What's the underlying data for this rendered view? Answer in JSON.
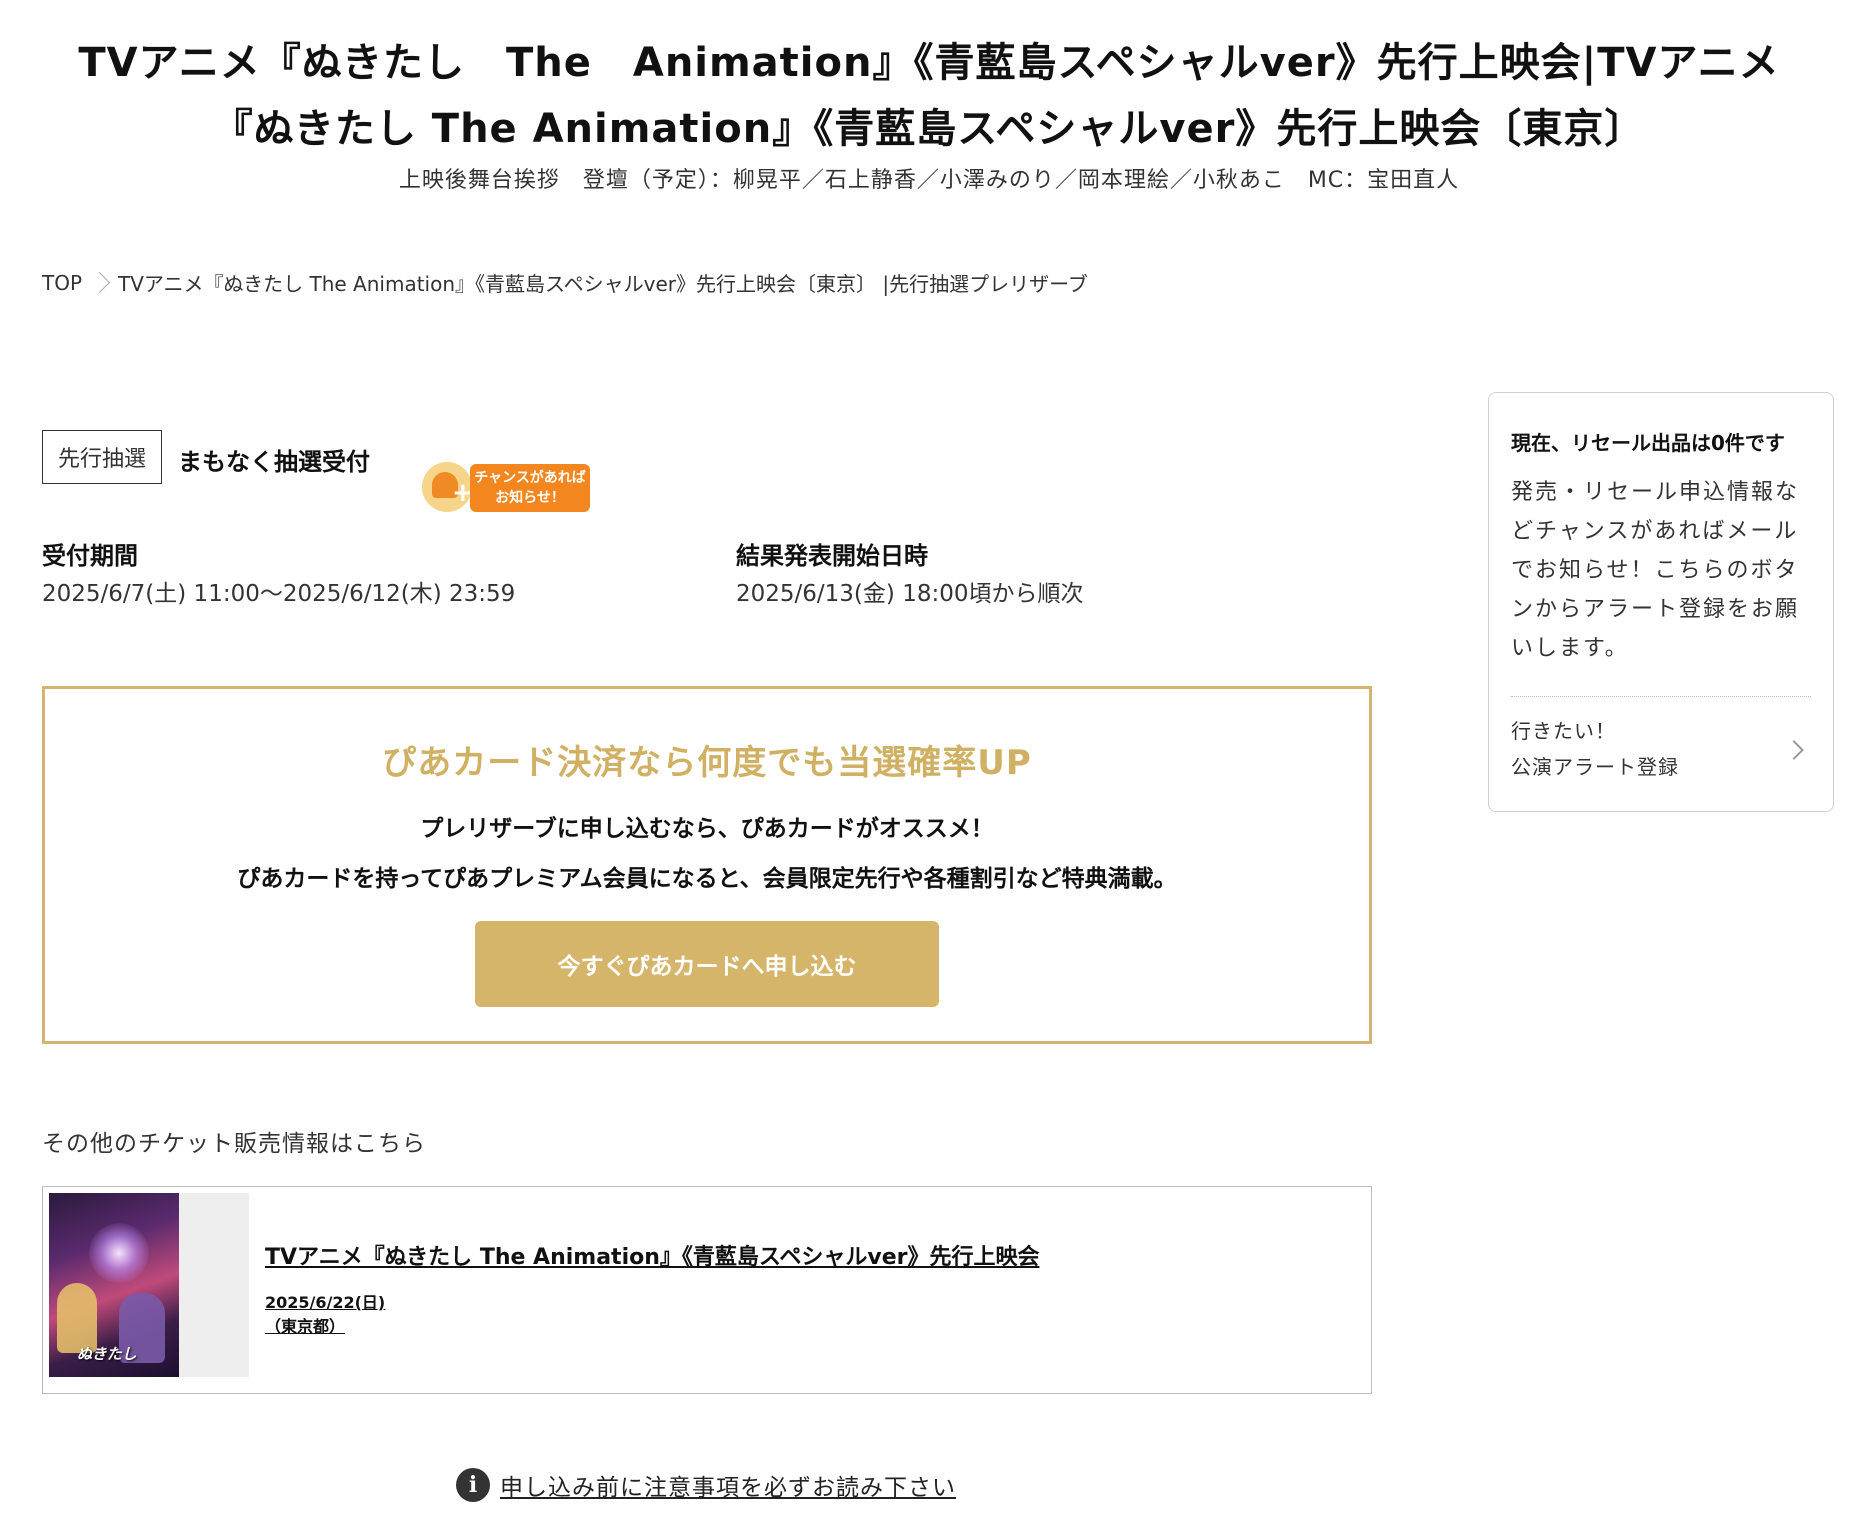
{
  "header": {
    "title": "TVアニメ『ぬきたし　The　Animation』《青藍島スペシャルver》先行上映会|TVアニメ『ぬきたし The Animation』《青藍島スペシャルver》先行上映会〔東京〕",
    "subtitle": "上映後舞台挨拶　登壇（予定）：柳晃平／石上静香／小澤みのり／岡本理絵／小秋あこ　MC：宝田直人"
  },
  "breadcrumb": {
    "home": "TOP",
    "current": "TVアニメ『ぬきたし The Animation』《青藍島スペシャルver》先行上映会〔東京〕 |先行抽選プレリザーブ"
  },
  "sale": {
    "type_tag": "先行抽選",
    "status": "まもなく抽選受付",
    "alert_badge": {
      "line1": "チャンスがあれば",
      "line2": "お知らせ！"
    },
    "period_label": "受付期間",
    "period_value": "2025/6/7(土) 11:00～2025/6/12(木) 23:59",
    "result_label": "結果発表開始日時",
    "result_value": "2025/6/13(金) 18:00頃から順次"
  },
  "promo": {
    "heading": "ぴあカード決済なら何度でも当選確率UP",
    "line1": "プレリザーブに申し込むなら、ぴあカードがオススメ！",
    "line2": "ぴあカードを持ってぴあプレミアム会員になると、会員限定先行や各種割引など特典満載。",
    "button_label": "今すぐぴあカードへ申し込む"
  },
  "other_tickets": {
    "heading": "その他のチケット販売情報はこちら",
    "events": [
      {
        "title": "TVアニメ『ぬきたし The Animation』《青藍島スペシャルver》先行上映会",
        "date": "2025/6/22(日)",
        "place": "（東京都）",
        "thumb_logo": "ぬきたし"
      }
    ]
  },
  "notice": {
    "icon": "info-icon",
    "text": "申し込み前に注意事項を必ずお読み下さい"
  },
  "resale_panel": {
    "heading": "現在、リセール出品は0件です",
    "body": "発売・リセール申込情報などチャンスがあればメールでお知らせ！こちらのボタンからアラート登録をお願いします。",
    "link_line1": "行きたい！",
    "link_line2": "公演アラート登録"
  },
  "colors": {
    "accent_gold": "#d5b56a",
    "alert_orange": "#f4861f"
  }
}
